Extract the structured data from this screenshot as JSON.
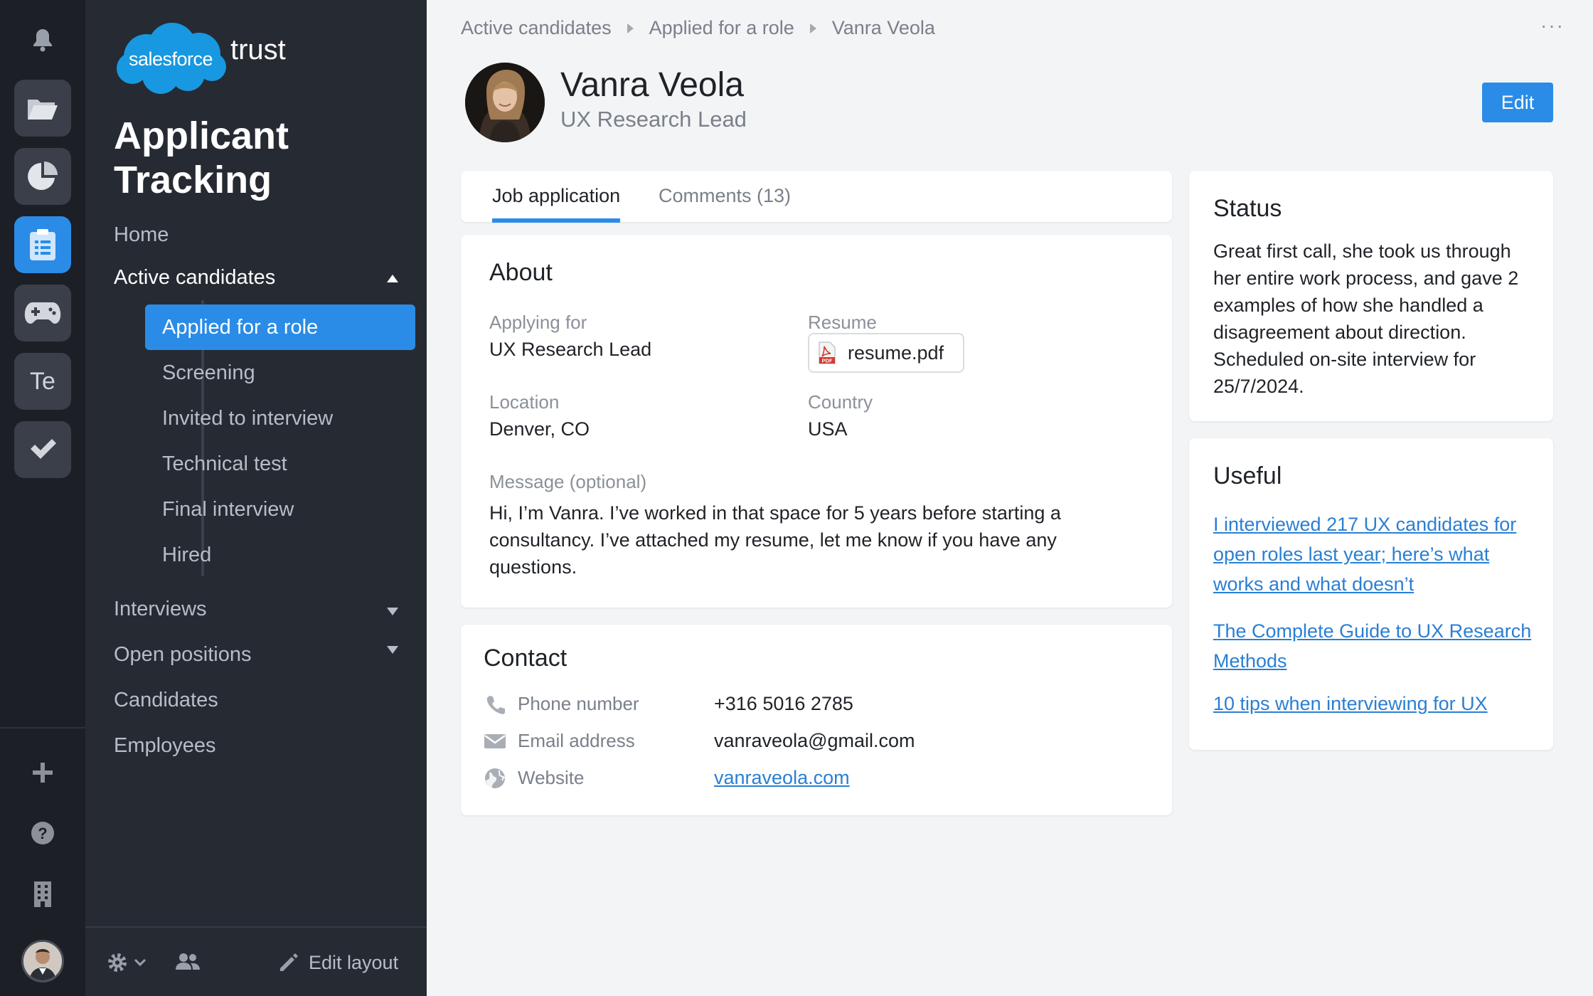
{
  "app": {
    "brand_logo_text": "salesforce",
    "brand_suffix": "trust",
    "title": "Applicant Tracking"
  },
  "rail": {
    "icons": [
      "bell-icon",
      "folder-icon",
      "pie-chart-icon",
      "clipboard-icon",
      "gamepad-icon",
      "te-app",
      "checkmark-icon",
      "plus-icon",
      "help-icon",
      "building-icon"
    ],
    "te_label": "Te"
  },
  "nav": {
    "home": "Home",
    "active_candidates": "Active candidates",
    "sub_items": [
      "Applied for a role",
      "Screening",
      "Invited to interview",
      "Technical test",
      "Final interview",
      "Hired"
    ],
    "interviews": "Interviews",
    "open_positions": "Open positions",
    "candidates": "Candidates",
    "employees": "Employees",
    "edit_layout": "Edit layout"
  },
  "breadcrumb": [
    "Active candidates",
    "Applied for a role",
    "Vanra Veola"
  ],
  "more": "···",
  "profile": {
    "name": "Vanra Veola",
    "role": "UX Research Lead",
    "edit_label": "Edit"
  },
  "tabs": {
    "job_application": "Job application",
    "comments": "Comments (13)"
  },
  "about": {
    "title": "About",
    "applying_for_label": "Applying for",
    "applying_for_value": "UX Research Lead",
    "resume_label": "Resume",
    "resume_file": "resume.pdf",
    "pdf_tag": "PDF",
    "location_label": "Location",
    "location_value": "Denver, CO",
    "country_label": "Country",
    "country_value": "USA",
    "message_label": "Message (optional)",
    "message_value": "Hi, I’m Vanra. I’ve worked in that space for 5 years before starting a consultancy. I’ve attached my resume, let me know if you have any questions."
  },
  "contact": {
    "title": "Contact",
    "phone_label": "Phone number",
    "phone_value": "+316 5016 2785",
    "email_label": "Email address",
    "email_value": "vanraveola@gmail.com",
    "website_label": "Website",
    "website_value": "vanraveola.com"
  },
  "status": {
    "title": "Status",
    "text": "Great first call, she took us through her entire work process, and gave 2 examples of how she handled a disagreement about direction. Scheduled on-site interview for 25/7/2024."
  },
  "useful": {
    "title": "Useful",
    "links": [
      "I interviewed 217 UX candidates for open roles last year; here’s what works and what doesn’t",
      "The Complete Guide to UX Research Methods",
      "10 tips when interviewing for UX"
    ]
  },
  "colors": {
    "accent": "#2a8ce6",
    "rail_bg": "#1c1f26",
    "nav_bg": "#262a33",
    "content_bg": "#f3f4f6",
    "link": "#2a7fd4"
  }
}
